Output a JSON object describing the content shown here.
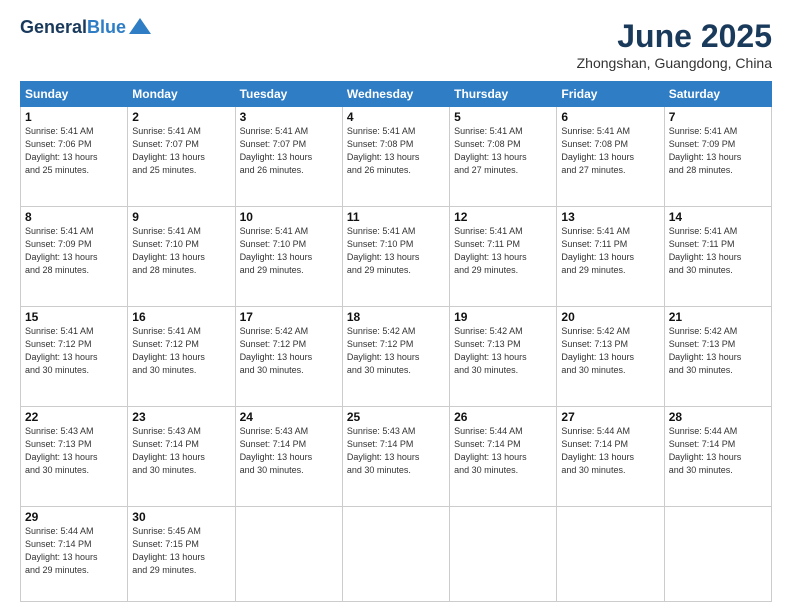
{
  "logo": {
    "line1": "General",
    "line2": "Blue"
  },
  "title": "June 2025",
  "location": "Zhongshan, Guangdong, China",
  "days_of_week": [
    "Sunday",
    "Monday",
    "Tuesday",
    "Wednesday",
    "Thursday",
    "Friday",
    "Saturday"
  ],
  "weeks": [
    [
      {
        "day": "1",
        "info": "Sunrise: 5:41 AM\nSunset: 7:06 PM\nDaylight: 13 hours\nand 25 minutes."
      },
      {
        "day": "2",
        "info": "Sunrise: 5:41 AM\nSunset: 7:07 PM\nDaylight: 13 hours\nand 25 minutes."
      },
      {
        "day": "3",
        "info": "Sunrise: 5:41 AM\nSunset: 7:07 PM\nDaylight: 13 hours\nand 26 minutes."
      },
      {
        "day": "4",
        "info": "Sunrise: 5:41 AM\nSunset: 7:08 PM\nDaylight: 13 hours\nand 26 minutes."
      },
      {
        "day": "5",
        "info": "Sunrise: 5:41 AM\nSunset: 7:08 PM\nDaylight: 13 hours\nand 27 minutes."
      },
      {
        "day": "6",
        "info": "Sunrise: 5:41 AM\nSunset: 7:08 PM\nDaylight: 13 hours\nand 27 minutes."
      },
      {
        "day": "7",
        "info": "Sunrise: 5:41 AM\nSunset: 7:09 PM\nDaylight: 13 hours\nand 28 minutes."
      }
    ],
    [
      {
        "day": "8",
        "info": "Sunrise: 5:41 AM\nSunset: 7:09 PM\nDaylight: 13 hours\nand 28 minutes."
      },
      {
        "day": "9",
        "info": "Sunrise: 5:41 AM\nSunset: 7:10 PM\nDaylight: 13 hours\nand 28 minutes."
      },
      {
        "day": "10",
        "info": "Sunrise: 5:41 AM\nSunset: 7:10 PM\nDaylight: 13 hours\nand 29 minutes."
      },
      {
        "day": "11",
        "info": "Sunrise: 5:41 AM\nSunset: 7:10 PM\nDaylight: 13 hours\nand 29 minutes."
      },
      {
        "day": "12",
        "info": "Sunrise: 5:41 AM\nSunset: 7:11 PM\nDaylight: 13 hours\nand 29 minutes."
      },
      {
        "day": "13",
        "info": "Sunrise: 5:41 AM\nSunset: 7:11 PM\nDaylight: 13 hours\nand 29 minutes."
      },
      {
        "day": "14",
        "info": "Sunrise: 5:41 AM\nSunset: 7:11 PM\nDaylight: 13 hours\nand 30 minutes."
      }
    ],
    [
      {
        "day": "15",
        "info": "Sunrise: 5:41 AM\nSunset: 7:12 PM\nDaylight: 13 hours\nand 30 minutes."
      },
      {
        "day": "16",
        "info": "Sunrise: 5:41 AM\nSunset: 7:12 PM\nDaylight: 13 hours\nand 30 minutes."
      },
      {
        "day": "17",
        "info": "Sunrise: 5:42 AM\nSunset: 7:12 PM\nDaylight: 13 hours\nand 30 minutes."
      },
      {
        "day": "18",
        "info": "Sunrise: 5:42 AM\nSunset: 7:12 PM\nDaylight: 13 hours\nand 30 minutes."
      },
      {
        "day": "19",
        "info": "Sunrise: 5:42 AM\nSunset: 7:13 PM\nDaylight: 13 hours\nand 30 minutes."
      },
      {
        "day": "20",
        "info": "Sunrise: 5:42 AM\nSunset: 7:13 PM\nDaylight: 13 hours\nand 30 minutes."
      },
      {
        "day": "21",
        "info": "Sunrise: 5:42 AM\nSunset: 7:13 PM\nDaylight: 13 hours\nand 30 minutes."
      }
    ],
    [
      {
        "day": "22",
        "info": "Sunrise: 5:43 AM\nSunset: 7:13 PM\nDaylight: 13 hours\nand 30 minutes."
      },
      {
        "day": "23",
        "info": "Sunrise: 5:43 AM\nSunset: 7:14 PM\nDaylight: 13 hours\nand 30 minutes."
      },
      {
        "day": "24",
        "info": "Sunrise: 5:43 AM\nSunset: 7:14 PM\nDaylight: 13 hours\nand 30 minutes."
      },
      {
        "day": "25",
        "info": "Sunrise: 5:43 AM\nSunset: 7:14 PM\nDaylight: 13 hours\nand 30 minutes."
      },
      {
        "day": "26",
        "info": "Sunrise: 5:44 AM\nSunset: 7:14 PM\nDaylight: 13 hours\nand 30 minutes."
      },
      {
        "day": "27",
        "info": "Sunrise: 5:44 AM\nSunset: 7:14 PM\nDaylight: 13 hours\nand 30 minutes."
      },
      {
        "day": "28",
        "info": "Sunrise: 5:44 AM\nSunset: 7:14 PM\nDaylight: 13 hours\nand 30 minutes."
      }
    ],
    [
      {
        "day": "29",
        "info": "Sunrise: 5:44 AM\nSunset: 7:14 PM\nDaylight: 13 hours\nand 29 minutes."
      },
      {
        "day": "30",
        "info": "Sunrise: 5:45 AM\nSunset: 7:15 PM\nDaylight: 13 hours\nand 29 minutes."
      },
      {
        "day": "",
        "info": ""
      },
      {
        "day": "",
        "info": ""
      },
      {
        "day": "",
        "info": ""
      },
      {
        "day": "",
        "info": ""
      },
      {
        "day": "",
        "info": ""
      }
    ]
  ]
}
